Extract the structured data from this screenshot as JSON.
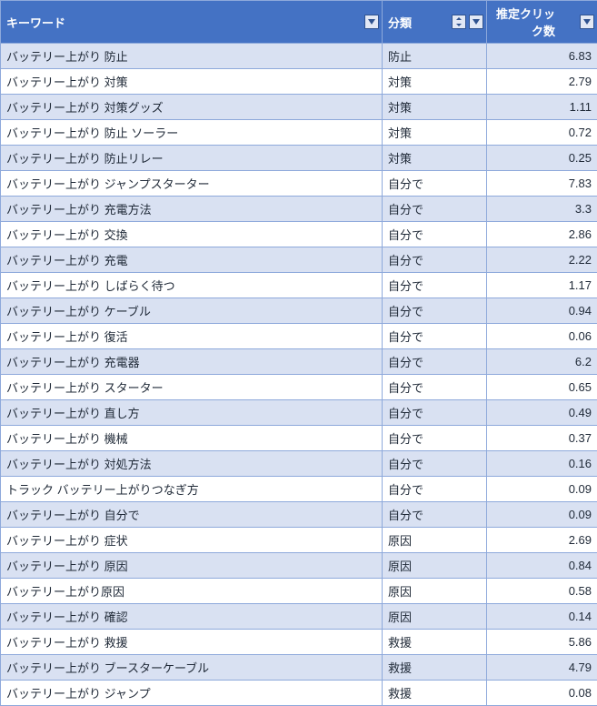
{
  "columns": {
    "keyword": "キーワード",
    "category": "分類",
    "clicks": "推定クリック数"
  },
  "rows": [
    {
      "keyword": "バッテリー上がり 防止",
      "category": "防止",
      "clicks": "6.83"
    },
    {
      "keyword": "バッテリー上がり 対策",
      "category": "対策",
      "clicks": "2.79"
    },
    {
      "keyword": "バッテリー上がり 対策グッズ",
      "category": "対策",
      "clicks": "1.11"
    },
    {
      "keyword": "バッテリー上がり 防止 ソーラー",
      "category": "対策",
      "clicks": "0.72"
    },
    {
      "keyword": "バッテリー上がり 防止リレー",
      "category": "対策",
      "clicks": "0.25"
    },
    {
      "keyword": "バッテリー上がり ジャンプスターター",
      "category": "自分で",
      "clicks": "7.83"
    },
    {
      "keyword": "バッテリー上がり 充電方法",
      "category": "自分で",
      "clicks": "3.3"
    },
    {
      "keyword": "バッテリー上がり 交換",
      "category": "自分で",
      "clicks": "2.86"
    },
    {
      "keyword": "バッテリー上がり 充電",
      "category": "自分で",
      "clicks": "2.22"
    },
    {
      "keyword": "バッテリー上がり しばらく待つ",
      "category": "自分で",
      "clicks": "1.17"
    },
    {
      "keyword": "バッテリー上がり ケーブル",
      "category": "自分で",
      "clicks": "0.94"
    },
    {
      "keyword": "バッテリー上がり 復活",
      "category": "自分で",
      "clicks": "0.06"
    },
    {
      "keyword": "バッテリー上がり 充電器",
      "category": "自分で",
      "clicks": "6.2"
    },
    {
      "keyword": "バッテリー上がり スターター",
      "category": "自分で",
      "clicks": "0.65"
    },
    {
      "keyword": "バッテリー上がり 直し方",
      "category": "自分で",
      "clicks": "0.49"
    },
    {
      "keyword": "バッテリー上がり 機械",
      "category": "自分で",
      "clicks": "0.37"
    },
    {
      "keyword": "バッテリー上がり 対処方法",
      "category": "自分で",
      "clicks": "0.16"
    },
    {
      "keyword": "トラック バッテリー上がりつなぎ方",
      "category": "自分で",
      "clicks": "0.09"
    },
    {
      "keyword": "バッテリー上がり 自分で",
      "category": "自分で",
      "clicks": "0.09"
    },
    {
      "keyword": "バッテリー上がり 症状",
      "category": "原因",
      "clicks": "2.69"
    },
    {
      "keyword": "バッテリー上がり 原因",
      "category": "原因",
      "clicks": "0.84"
    },
    {
      "keyword": "バッテリー上がり原因",
      "category": "原因",
      "clicks": "0.58"
    },
    {
      "keyword": "バッテリー上がり 確認",
      "category": "原因",
      "clicks": "0.14"
    },
    {
      "keyword": "バッテリー上がり 救援",
      "category": "救援",
      "clicks": "5.86"
    },
    {
      "keyword": "バッテリー上がり ブースターケーブル",
      "category": "救援",
      "clicks": "4.79"
    },
    {
      "keyword": "バッテリー上がり ジャンプ",
      "category": "救援",
      "clicks": "0.08"
    }
  ]
}
